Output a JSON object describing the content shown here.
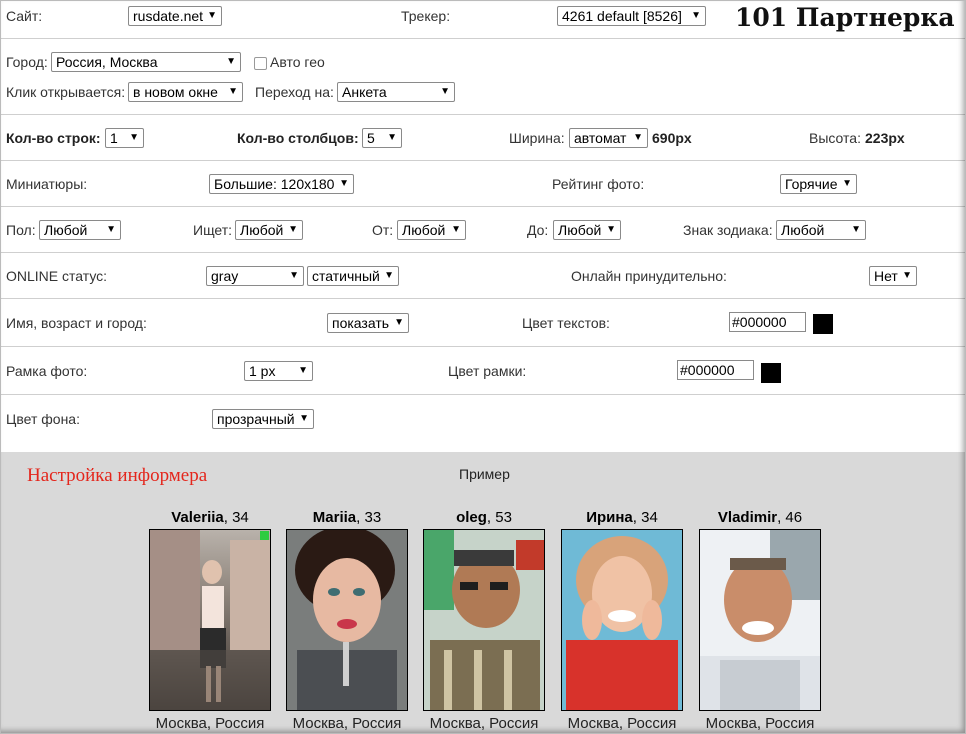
{
  "logo": "101 Партнерка",
  "row1": {
    "site_label": "Сайт:",
    "site_value": "rusdate.net",
    "tracker_label": "Трекер:",
    "tracker_value": "4261 default [8526]"
  },
  "row2": {
    "city_label": "Город:",
    "city_value": "Россия, Москва",
    "autogeo_label": "Авто гео",
    "click_label": "Клик открывается:",
    "click_value": "в новом окне",
    "goto_label": "Переход на:",
    "goto_value": "Анкета"
  },
  "row3": {
    "rows_label": "Кол-во строк:",
    "rows_value": "1",
    "cols_label": "Кол-во столбцов:",
    "cols_value": "5",
    "width_label": "Ширина:",
    "width_value": "автомат",
    "width_px": "690px",
    "height_label": "Высота:",
    "height_px": "223px"
  },
  "row4": {
    "thumbs_label": "Миниатюры:",
    "thumbs_value": "Большие: 120x180",
    "rating_label": "Рейтинг фото:",
    "rating_value": "Горячие"
  },
  "row5": {
    "sex_label": "Пол:",
    "sex_value": "Любой",
    "seek_label": "Ищет:",
    "seek_value": "Любой",
    "from_label": "От:",
    "from_value": "Любой",
    "to_label": "До:",
    "to_value": "Любой",
    "zodiac_label": "Знак зодиака:",
    "zodiac_value": "Любой"
  },
  "row6": {
    "online_label": "ONLINE статус:",
    "online_color": "gray",
    "online_mode": "статичный",
    "force_label": "Онлайн принудительно:",
    "force_value": "Нет"
  },
  "row7": {
    "name_label": "Имя, возраст и город:",
    "name_value": "показать",
    "textcolor_label": "Цвет текстов:",
    "textcolor_value": "#000000"
  },
  "row8": {
    "frame_label": "Рамка фото:",
    "frame_value": "1 px",
    "framecolor_label": "Цвет рамки:",
    "framecolor_value": "#000000"
  },
  "row9": {
    "bg_label": "Цвет фона:",
    "bg_value": "прозрачный"
  },
  "preview": {
    "title": "Настройка информера",
    "example": "Пример",
    "cards": [
      {
        "name": "Valeriia",
        "age": ", 34",
        "city": "Москва, Россия",
        "online": true
      },
      {
        "name": "Mariia",
        "age": ", 33",
        "city": "Москва, Россия",
        "online": false
      },
      {
        "name": "oleg",
        "age": ", 53",
        "city": "Москва, Россия",
        "online": false
      },
      {
        "name": "Ирина",
        "age": ", 34",
        "city": "Москва, Россия",
        "online": false
      },
      {
        "name": "Vladimir",
        "age": ", 46",
        "city": "Москва, Россия",
        "online": false
      }
    ]
  },
  "colors": {
    "accent_title": "#e4261c",
    "online_badge": "#2ecc40",
    "swatch": "#000000"
  }
}
